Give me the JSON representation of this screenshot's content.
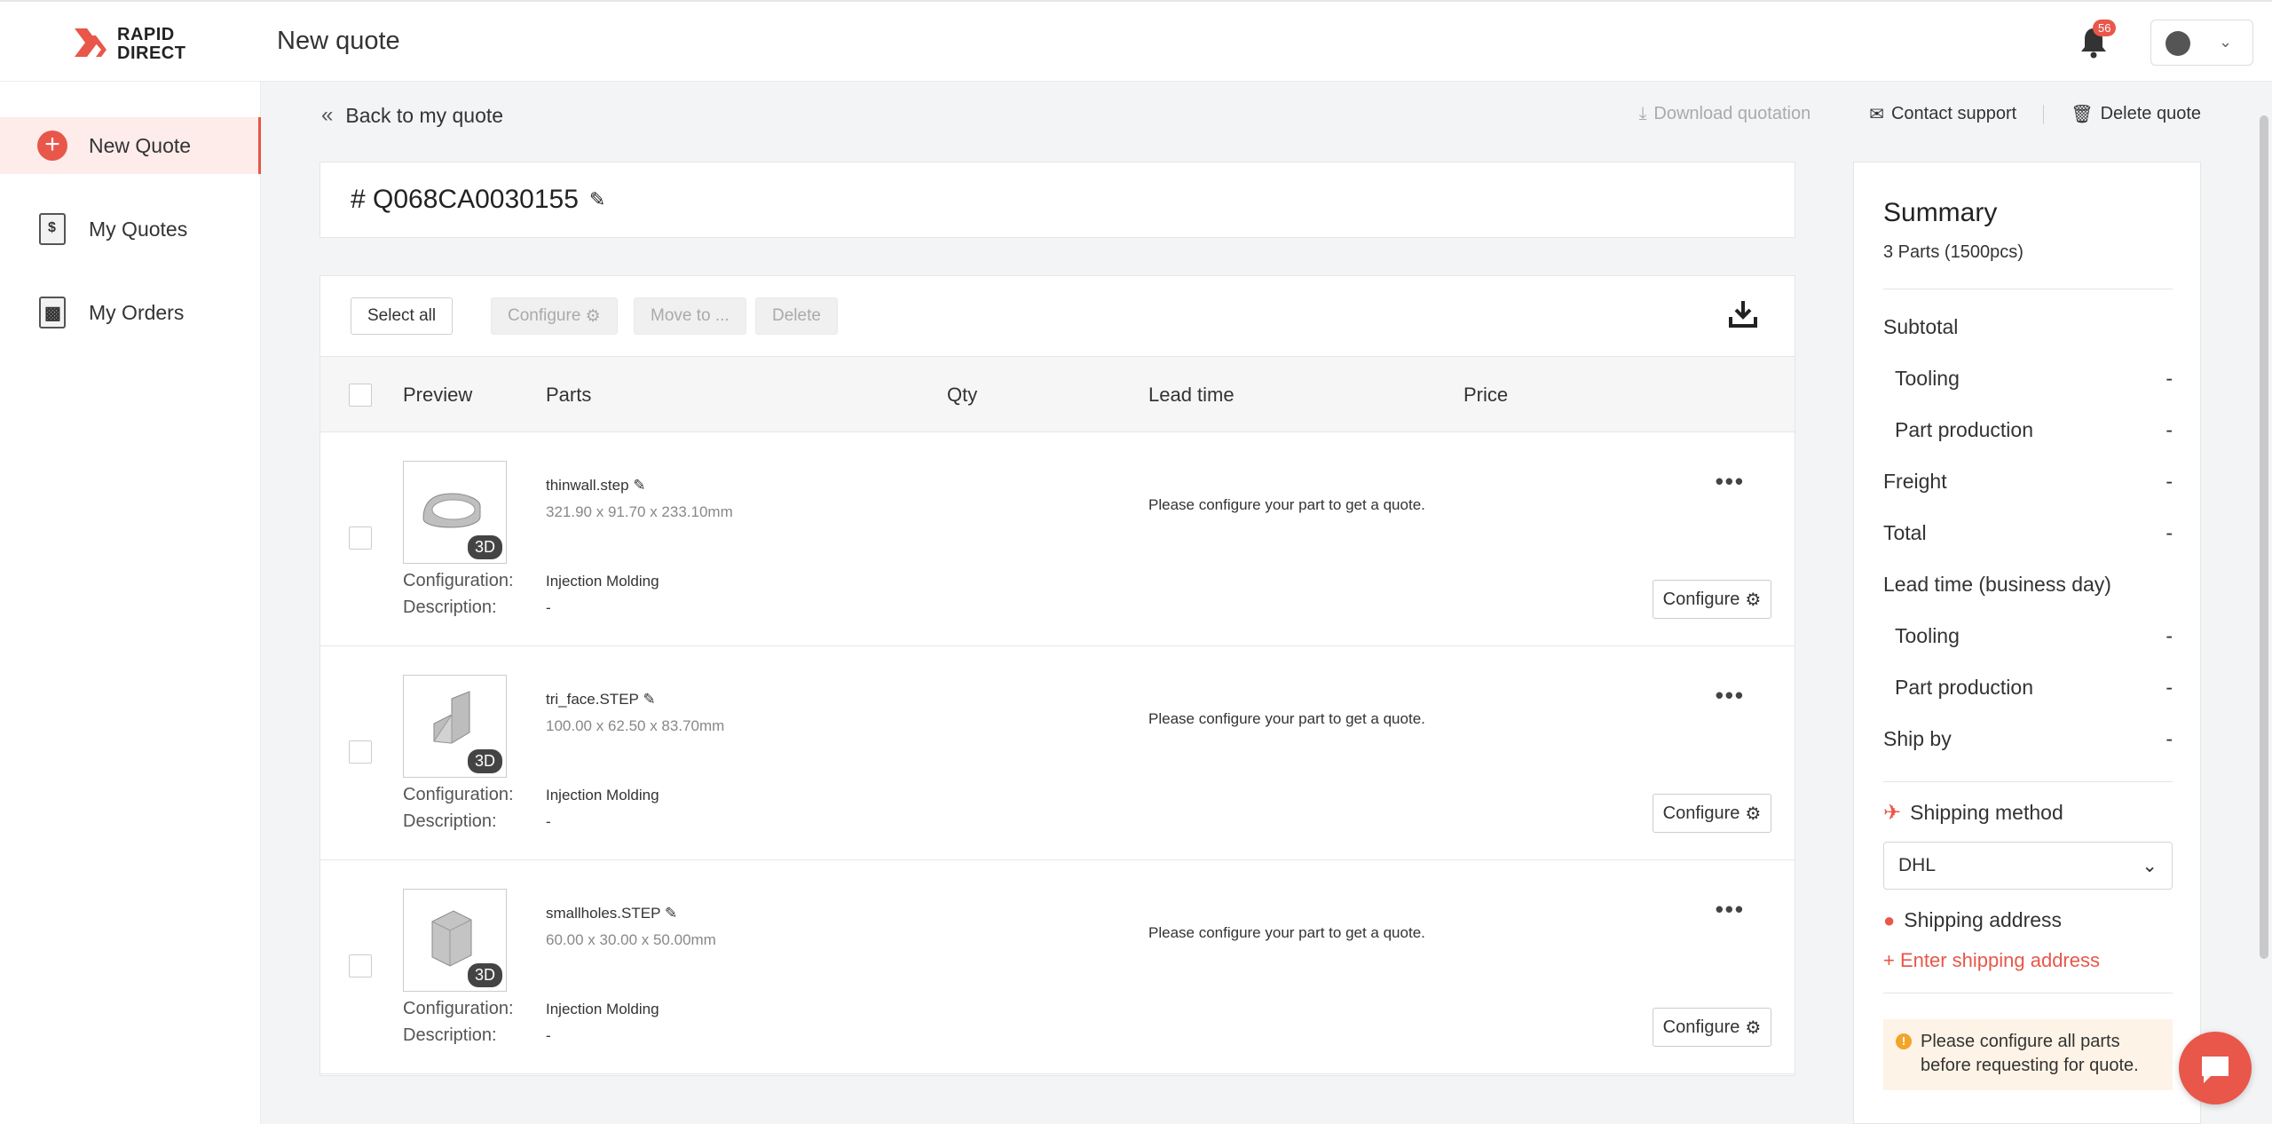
{
  "header": {
    "logo_line1": "RAPID",
    "logo_line2": "DIRECT",
    "title": "New quote",
    "notification_count": "56"
  },
  "sidebar": {
    "items": [
      {
        "label": "New Quote",
        "icon": "plus-circle-icon",
        "active": true
      },
      {
        "label": "My Quotes",
        "icon": "quote-document-icon",
        "active": false
      },
      {
        "label": "My Orders",
        "icon": "order-document-icon",
        "active": false
      }
    ]
  },
  "nav": {
    "back_label": "Back to my quote",
    "download_label": "Download quotation",
    "contact_label": "Contact support",
    "delete_quote_label": "Delete quote"
  },
  "quote": {
    "id": "# Q068CA0030155"
  },
  "toolbar": {
    "select_all": "Select all",
    "configure": "Configure",
    "move_to": "Move to ...",
    "delete": "Delete"
  },
  "table": {
    "headers": {
      "preview": "Preview",
      "parts": "Parts",
      "qty": "Qty",
      "lead_time": "Lead time",
      "price": "Price"
    },
    "config_label": "Configuration:",
    "desc_label": "Description:",
    "rows": [
      {
        "file": "thinwall.step",
        "dims": "321.90 x 91.70 x 233.10mm",
        "configuration": "Injection Molding",
        "description": "-",
        "message": "Please configure your part to get a quote.",
        "badge": "3D",
        "configure": "Configure"
      },
      {
        "file": "tri_face.STEP",
        "dims": "100.00 x 62.50 x 83.70mm",
        "configuration": "Injection Molding",
        "description": "-",
        "message": "Please configure your part to get a quote.",
        "badge": "3D",
        "configure": "Configure"
      },
      {
        "file": "smallholes.STEP",
        "dims": "60.00 x 30.00 x 50.00mm",
        "configuration": "Injection Molding",
        "description": "-",
        "message": "Please configure your part to get a quote.",
        "badge": "3D",
        "configure": "Configure"
      }
    ]
  },
  "summary": {
    "title": "Summary",
    "parts_count": "3 Parts (1500pcs)",
    "subtotal": "Subtotal",
    "tooling": "Tooling",
    "tooling_value": "-",
    "part_production": "Part production",
    "part_production_value": "-",
    "freight": "Freight",
    "freight_value": "-",
    "total": "Total",
    "total_value": "-",
    "lead_time": "Lead time (business day)",
    "lt_tooling": "Tooling",
    "lt_tooling_value": "-",
    "lt_part_production": "Part production",
    "lt_part_production_value": "-",
    "ship_by": "Ship by",
    "ship_by_value": "-",
    "shipping_method": "Shipping method",
    "shipping_method_value": "DHL",
    "shipping_address": "Shipping address",
    "enter_address": "+ Enter shipping address",
    "warning": "Please configure all parts before requesting for quote."
  },
  "colors": {
    "accent": "#e8574a",
    "warning": "#f2a42b"
  }
}
